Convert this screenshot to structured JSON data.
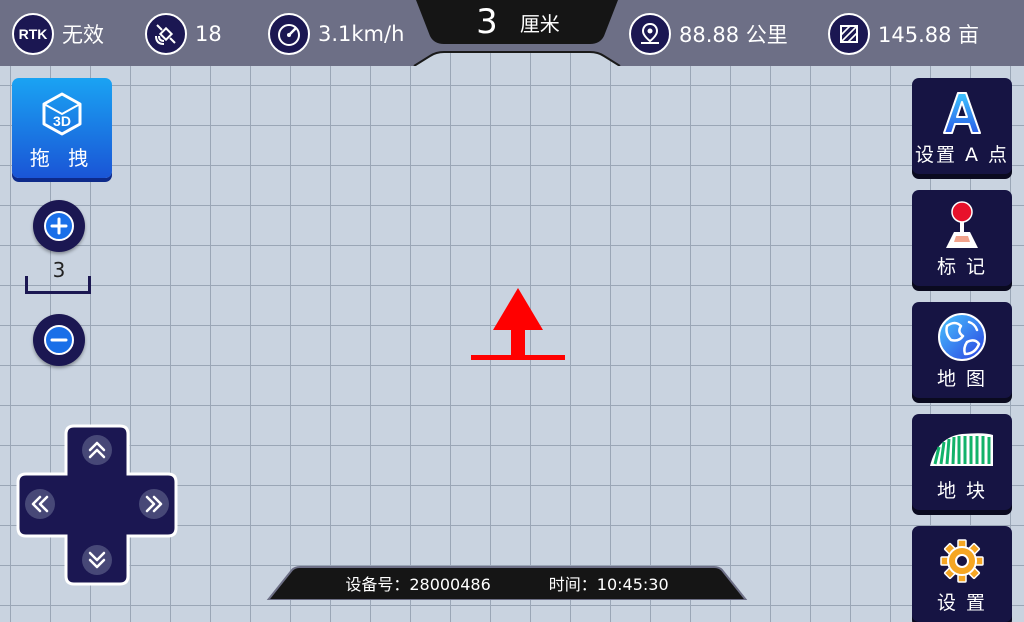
{
  "status": {
    "rtk": {
      "badge": "RTK",
      "value": "无效"
    },
    "satellites": {
      "icon": "satellite-icon",
      "value": "18"
    },
    "speed": {
      "icon": "speedometer-icon",
      "value": "3.1km/h"
    },
    "precision": {
      "value": "3",
      "unit": "厘米"
    },
    "distance": {
      "icon": "location-pin-icon",
      "value": "88.88 公里"
    },
    "area": {
      "icon": "area-icon",
      "value": "145.88 亩"
    }
  },
  "left": {
    "drag_label": "拖 拽",
    "drag_icon": "3d-cube-icon",
    "zoom_level": "3"
  },
  "menu": [
    {
      "id": "set-a-point",
      "label": "设置 A 点",
      "icon": "letter-a-icon"
    },
    {
      "id": "mark",
      "label": "标 记",
      "icon": "joystick-marker-icon"
    },
    {
      "id": "map",
      "label": "地 图",
      "icon": "globe-icon"
    },
    {
      "id": "field",
      "label": "地 块",
      "icon": "field-rows-icon"
    },
    {
      "id": "settings",
      "label": "设 置",
      "icon": "gear-icon"
    }
  ],
  "bottom": {
    "device": "设备号：28000486",
    "time": "时间：10:45:30"
  },
  "colors": {
    "bar": "#6d6f86",
    "navy": "#161443",
    "accent_blue": "#1a6fe8",
    "arrow_red": "#ff0000",
    "grid_bg": "#c9d3e0"
  }
}
